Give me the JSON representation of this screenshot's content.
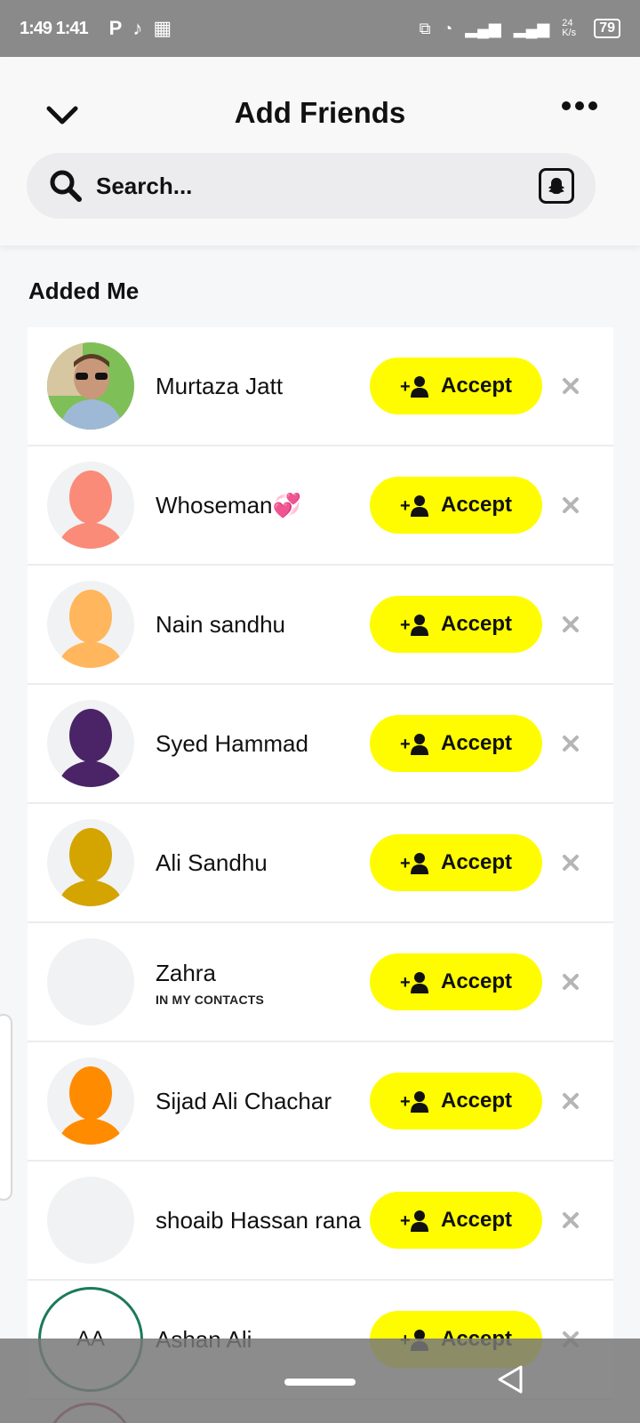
{
  "status_bar": {
    "time": "1:49 1:41",
    "apps": [
      "P",
      "♪",
      "▦"
    ],
    "battery": "79",
    "network": "24 K/s"
  },
  "header": {
    "title": "Add Friends"
  },
  "search": {
    "placeholder": "Search..."
  },
  "section": {
    "title": "Added Me"
  },
  "friends": [
    {
      "name": "Murtaza Jatt",
      "subtext": "",
      "avatar": "photo",
      "color": ""
    },
    {
      "name": "Whoseman💞",
      "subtext": "",
      "avatar": "silhouette",
      "color": "#f98b78"
    },
    {
      "name": "Nain sandhu",
      "subtext": "",
      "avatar": "silhouette",
      "color": "#ffb65c"
    },
    {
      "name": "Syed Hammad",
      "subtext": "",
      "avatar": "silhouette",
      "color": "#4a2466"
    },
    {
      "name": "Ali Sandhu",
      "subtext": "",
      "avatar": "silhouette",
      "color": "#d4a400"
    },
    {
      "name": "Zahra",
      "subtext": "IN MY CONTACTS",
      "avatar": "blank",
      "color": ""
    },
    {
      "name": "Sijad Ali Chachar",
      "subtext": "",
      "avatar": "silhouette",
      "color": "#ff8c00"
    },
    {
      "name": "shoaib Hassan rana",
      "subtext": "",
      "avatar": "blank",
      "color": ""
    },
    {
      "name": "Ashan Ali",
      "subtext": "",
      "avatar": "initials",
      "initials": "AA",
      "color": "#1c7a5a"
    }
  ],
  "accept_label": "Accept",
  "accent_color": "#fffc00"
}
